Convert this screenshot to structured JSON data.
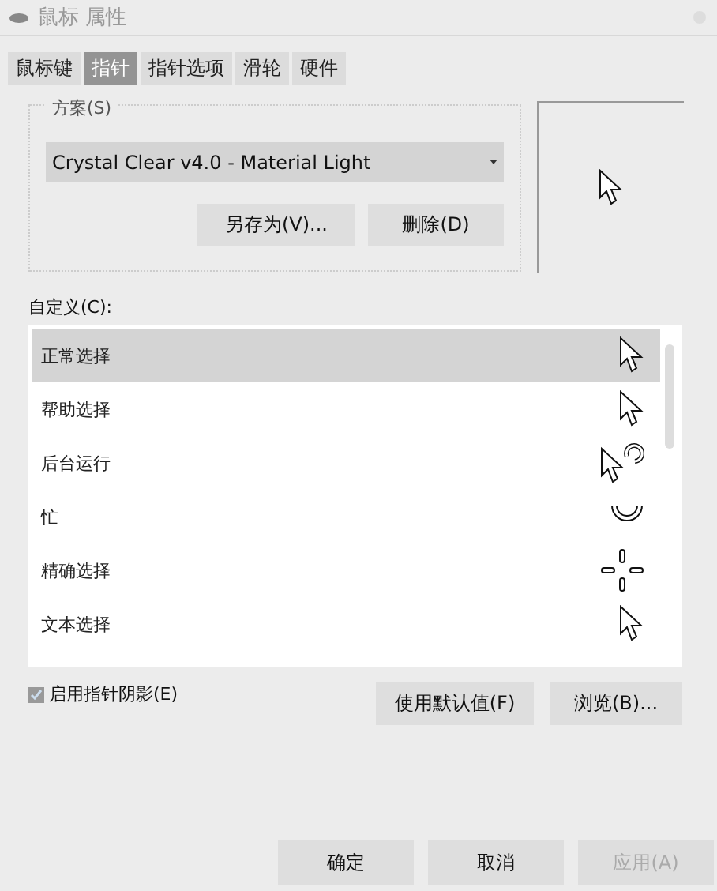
{
  "window": {
    "title": "鼠标 属性"
  },
  "tabs": [
    {
      "label": "鼠标键",
      "selected": false
    },
    {
      "label": "指针",
      "selected": true
    },
    {
      "label": "指针选项",
      "selected": false
    },
    {
      "label": "滑轮",
      "selected": false
    },
    {
      "label": "硬件",
      "selected": false
    }
  ],
  "scheme": {
    "label": "方案(S)",
    "value": "Crystal Clear v4.0 - Material Light",
    "buttons": [
      "另存为(V)...",
      "删除(D)"
    ]
  },
  "customize": {
    "label": "自定义(C):",
    "rows": [
      {
        "name": "正常选择",
        "kind": "arrow",
        "selected": true
      },
      {
        "name": "帮助选择",
        "kind": "arrow",
        "selected": false
      },
      {
        "name": "后台运行",
        "kind": "working",
        "selected": false
      },
      {
        "name": "忙",
        "kind": "busy",
        "selected": false
      },
      {
        "name": "精确选择",
        "kind": "cross",
        "selected": false
      },
      {
        "name": "文本选择",
        "kind": "arrow",
        "selected": false
      }
    ]
  },
  "shadow": {
    "label": "启用指针阴影(E)",
    "checked": true
  },
  "list_buttons": [
    "使用默认值(F)",
    "浏览(B)..."
  ],
  "footer": [
    {
      "label": "确定",
      "disabled": false
    },
    {
      "label": "取消",
      "disabled": false
    },
    {
      "label": "应用(A)",
      "disabled": true
    }
  ]
}
